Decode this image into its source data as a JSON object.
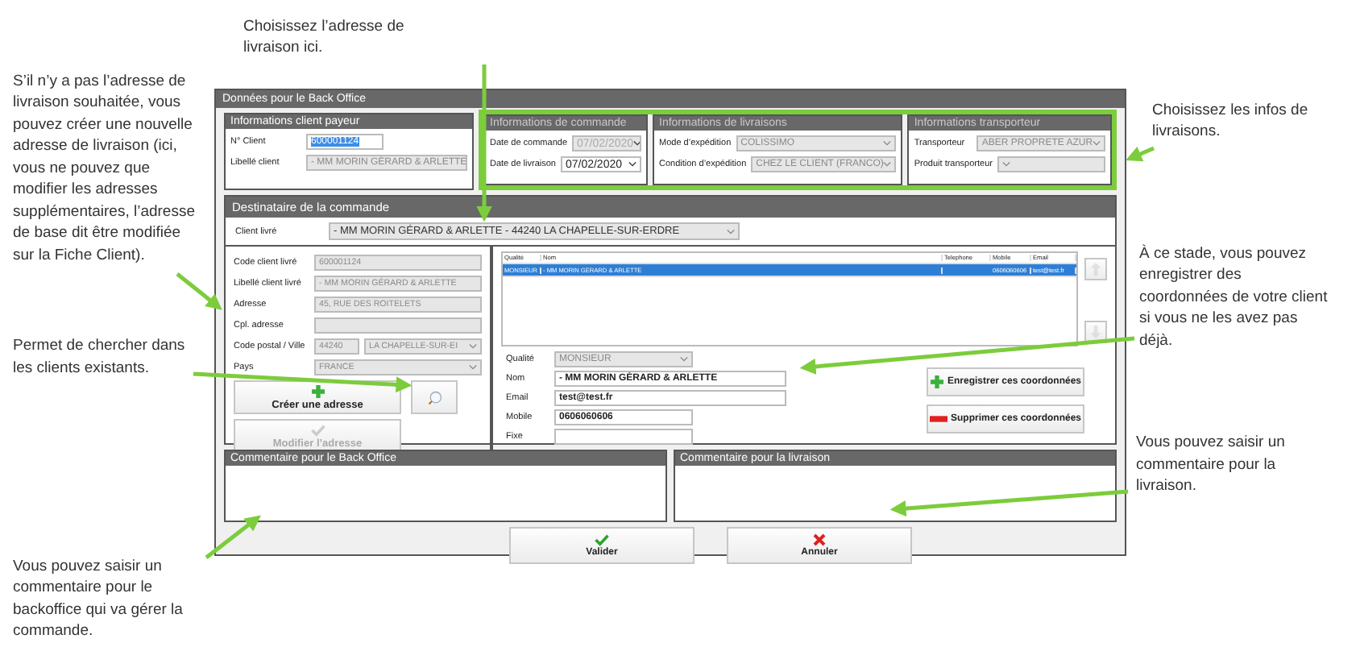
{
  "annotations": {
    "top": "Choisissez l’adresse de livraison ici.",
    "left_top": "S’il n’y a pas l’adresse de livraison souhaitée, vous pouvez créer une nouvelle adresse de livraison (ici, vous ne pouvez que modifier les adresses supplémentaires, l’adresse de base dit être modifiée sur la Fiche Client).",
    "left_middle": "Permet de chercher dans les clients existants.",
    "right_top": "Choisissez les infos de livraisons.",
    "right_middle": "À ce stade, vous pouvez enregistrer des coordonnées de votre client si vous ne les avez pas déjà.",
    "right_bottom": "Vous pouvez saisir un commentaire pour la livraison.",
    "bottom_left": "Vous pouvez saisir un commentaire pour le backoffice qui va gérer la commande."
  },
  "dialog": {
    "title": "Données pour le Back Office",
    "groups": [
      {
        "title": "Informations client payeur",
        "fields": [
          {
            "label": "N° Client",
            "value": "600001124",
            "kind": "text",
            "disabled": false,
            "highlighted": true
          },
          {
            "label": "Libellé client",
            "value": "- MM MORIN GÉRARD & ARLETTE",
            "kind": "text",
            "disabled": true,
            "highlighted": false
          }
        ]
      },
      {
        "title": "Informations de commande",
        "fields": [
          {
            "label": "Date de commande",
            "value": "07/02/2020",
            "kind": "date",
            "disabled": true
          },
          {
            "label": "Date de livraison",
            "value": "07/02/2020",
            "kind": "date",
            "disabled": false
          }
        ]
      },
      {
        "title": "Informations de livraisons",
        "fields": [
          {
            "label": "Mode d’expédition",
            "value": "COLISSIMO",
            "kind": "select",
            "disabled": true
          },
          {
            "label": "Condition d’expédition",
            "value": "CHEZ LE CLIENT (FRANCO)",
            "kind": "select",
            "disabled": true
          }
        ]
      },
      {
        "title": "Informations transporteur",
        "fields": [
          {
            "label": "Transporteur",
            "value": "ABER PROPRETE AZUR",
            "kind": "select",
            "disabled": true
          },
          {
            "label": "Produit transporteur",
            "kind": "select",
            "disabled": true
          }
        ]
      }
    ],
    "recipient": {
      "title": "Destinataire de la commande",
      "client_label": "Client livré",
      "client_value": "- MM MORIN GÉRARD & ARLETTE - 44240 LA CHAPELLE-SUR-ERDRE",
      "address_fields": [
        {
          "label": "Code client livré",
          "value": "600001124",
          "kind": "text",
          "disabled": true
        },
        {
          "label": "Libellé client livré",
          "value": "- MM MORIN GÉRARD & ARLETTE",
          "kind": "text",
          "disabled": true
        },
        {
          "label": "Adresse",
          "value": "45, RUE DES ROITELETS",
          "kind": "text",
          "disabled": true
        },
        {
          "label": "Cpl. adresse",
          "kind": "text",
          "disabled": true
        },
        {
          "label": "Code postal / Ville",
          "value": "44240",
          "second_value": "LA CHAPELLE-SUR-EI",
          "kind": "text",
          "disabled": true
        },
        {
          "label": "Pays",
          "value": "FRANCE",
          "kind": "select",
          "disabled": true
        }
      ],
      "address_buttons": [
        {
          "label": "Créer une adresse",
          "disabled": false
        },
        {
          "disabled": false
        },
        {
          "label": "Modifier l’adresse",
          "disabled": true
        }
      ],
      "table": {
        "columns": [
          "Qualité",
          "Nom",
          "Telephone",
          "Mobile",
          "Email"
        ],
        "rows": [
          {
            "cells": [
              "MONSIEUR",
              "- MM MORIN GÉRARD & ARLETTE",
              "",
              "0606060606",
              "test@test.fr"
            ],
            "selected": true
          }
        ]
      },
      "move_buttons": [
        {
          "disabled": true
        },
        {
          "disabled": true
        }
      ],
      "contact_fields": [
        {
          "label": "Qualité",
          "value": "MONSIEUR",
          "kind": "select",
          "disabled": true,
          "wide": false
        },
        {
          "label": "Nom",
          "value": "- MM MORIN GÉRARD & ARLETTE",
          "kind": "text",
          "disabled": false,
          "wide": true
        },
        {
          "label": "Email",
          "value": "test@test.fr",
          "kind": "text",
          "disabled": false,
          "wide": true
        },
        {
          "label": "Mobile",
          "value": "0606060606",
          "kind": "text",
          "disabled": false,
          "wide": false
        },
        {
          "label": "Fixe",
          "kind": "text",
          "disabled": false,
          "wide": false
        }
      ],
      "contact_buttons": [
        {
          "label": "Enregistrer ces coordonnées"
        },
        {
          "label": "Supprimer ces coordonnées"
        }
      ]
    },
    "comments": [
      "Commentaire pour le Back Office",
      "Commentaire pour la livraison"
    ],
    "footer_buttons": [
      {
        "label": "Valider"
      },
      {
        "label": "Annuler"
      }
    ]
  }
}
